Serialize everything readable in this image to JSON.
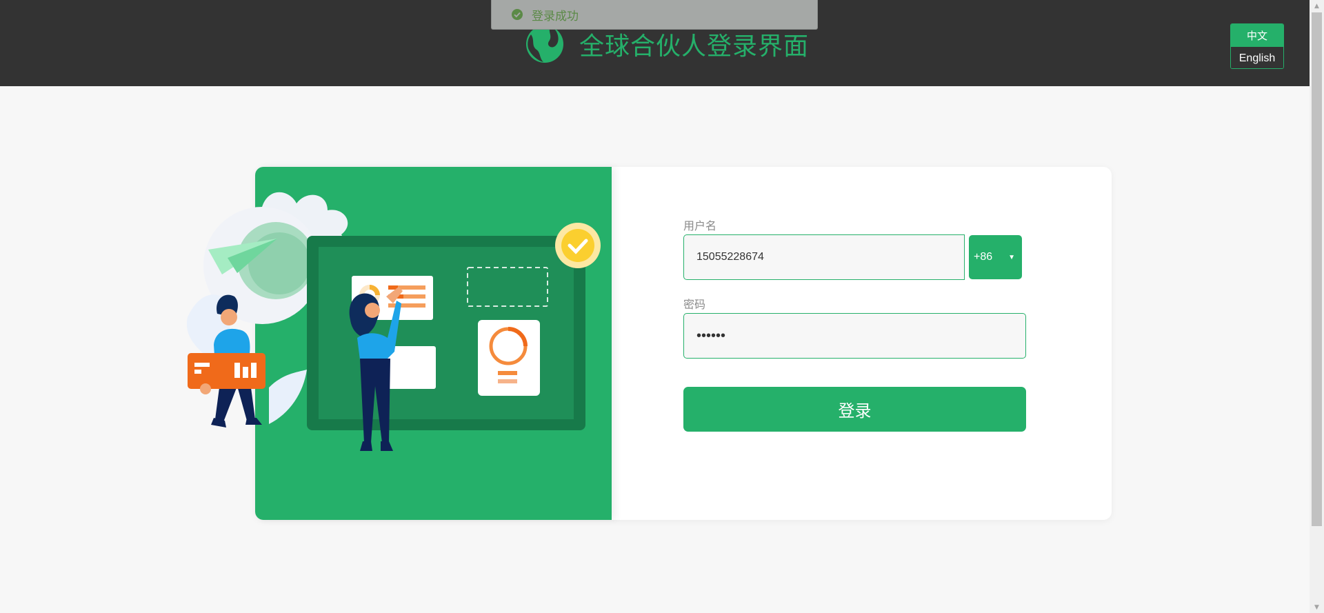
{
  "header": {
    "title": "全球合伙人登录界面",
    "logo_icon": "globe-leaf-logo"
  },
  "toast": {
    "message": "登录成功",
    "icon": "check-circle-icon"
  },
  "language": {
    "options": [
      "中文",
      "English"
    ],
    "selected": "中文"
  },
  "login_form": {
    "username_label": "用户名",
    "username_value": "15055228674",
    "country_code": "+86",
    "password_label": "密码",
    "password_value": "123456",
    "submit_label": "登录"
  },
  "colors": {
    "brand_green": "#25b06a",
    "header_bg": "#333333",
    "page_bg": "#f7f7f7"
  }
}
